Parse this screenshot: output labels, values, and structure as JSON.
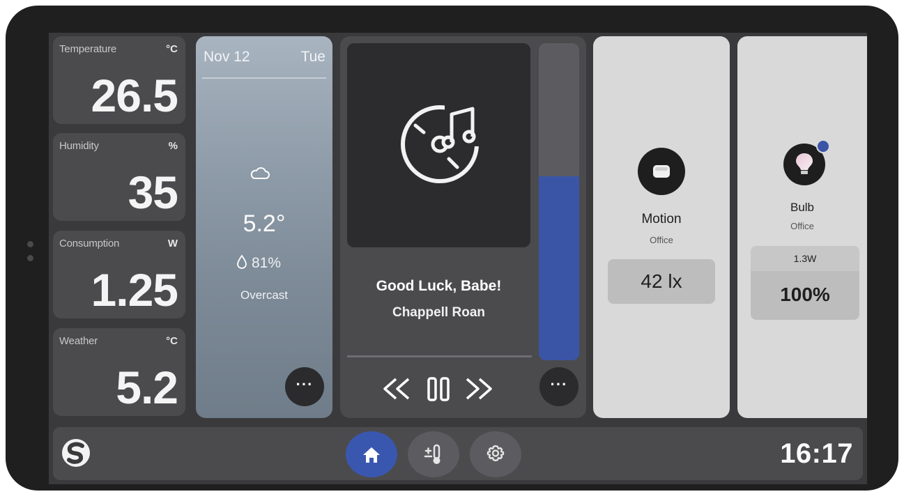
{
  "sensors": [
    {
      "label": "Temperature",
      "unit": "°C",
      "value": "26.5"
    },
    {
      "label": "Humidity",
      "unit": "%",
      "value": "35"
    },
    {
      "label": "Consumption",
      "unit": "W",
      "value": "1.25"
    },
    {
      "label": "Weather",
      "unit": "°C",
      "value": "5.2"
    }
  ],
  "weather": {
    "date": "Nov 12",
    "day": "Tue",
    "icon": "cloud-icon",
    "temperature": "5.2°",
    "humidity": "81%",
    "condition": "Overcast",
    "more_label": "···"
  },
  "media": {
    "title": "Good Luck, Babe!",
    "artist": "Chappell Roan",
    "art_icon": "music-disc-icon",
    "volume_fraction": 0.58,
    "more_label": "···"
  },
  "motion": {
    "name": "Motion",
    "room": "Office",
    "value": "42 lx",
    "icon": "motion-sensor-icon"
  },
  "bulb": {
    "name": "Bulb",
    "room": "Office",
    "power": "1.3W",
    "brightness": "100%",
    "icon": "bulb-icon",
    "status_dot_color": "#3b55a6"
  },
  "nav": {
    "items": [
      "home-icon",
      "thermostat-icon",
      "gear-icon"
    ],
    "active": "home-icon",
    "time": "16:17"
  },
  "colors": {
    "accent": "#3b55a6",
    "screen_bg": "#3a3a3c",
    "card_bg": "#4b4b4e",
    "light_tile": "#d9d9d9"
  }
}
